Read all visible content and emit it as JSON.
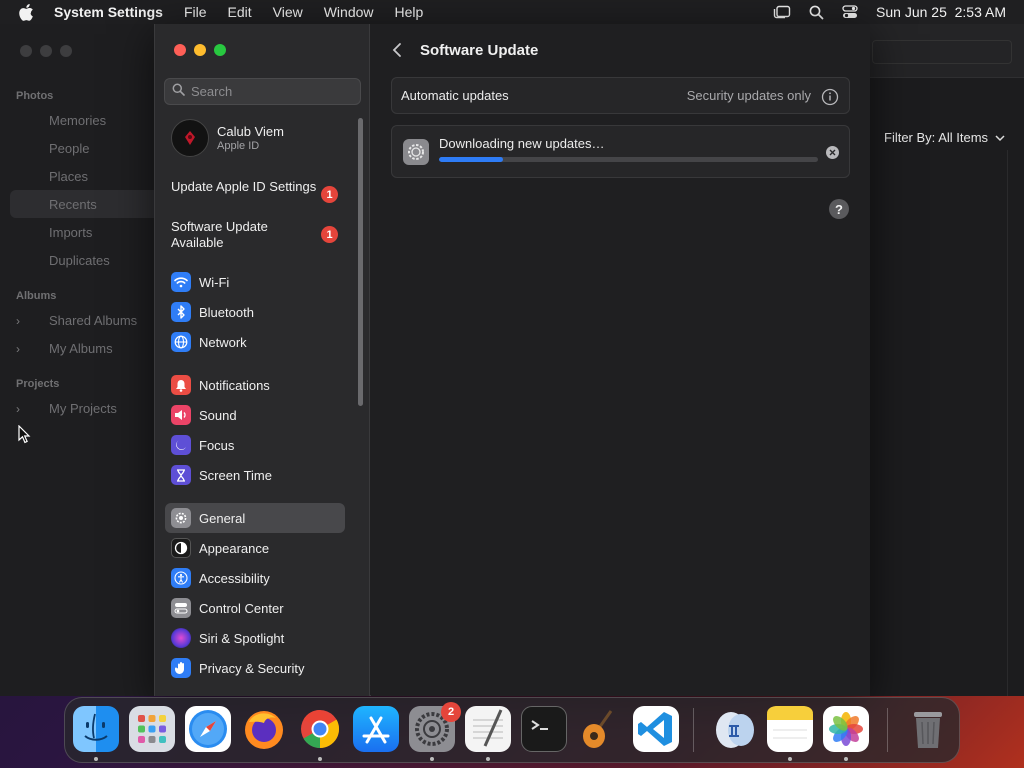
{
  "menubar": {
    "app_name": "System Settings",
    "menus": [
      "File",
      "Edit",
      "View",
      "Window",
      "Help"
    ],
    "datetime": "Sun Jun 25  2:53 AM"
  },
  "photos": {
    "sections": {
      "photos": "Photos",
      "albums": "Albums",
      "projects": "Projects"
    },
    "items": {
      "memories": "Memories",
      "people": "People",
      "places": "Places",
      "recents": "Recents",
      "imports": "Imports",
      "duplicates": "Duplicates",
      "shared_albums": "Shared Albums",
      "my_albums": "My Albums",
      "my_projects": "My Projects"
    },
    "filter_label": "Filter By:",
    "filter_value": "All Items"
  },
  "settings": {
    "search_placeholder": "Search",
    "user": {
      "name": "Calub Viem",
      "subtitle": "Apple ID"
    },
    "notices": [
      {
        "label": "Update Apple ID Settings",
        "badge": "1"
      },
      {
        "label": "Software Update Available",
        "badge": "1"
      }
    ],
    "sidebar": {
      "wifi": "Wi-Fi",
      "bluetooth": "Bluetooth",
      "network": "Network",
      "notifications": "Notifications",
      "sound": "Sound",
      "focus": "Focus",
      "screen_time": "Screen Time",
      "general": "General",
      "appearance": "Appearance",
      "accessibility": "Accessibility",
      "control_center": "Control Center",
      "siri": "Siri & Spotlight",
      "privacy": "Privacy & Security"
    },
    "selected": "General",
    "pane": {
      "title": "Software Update",
      "auto_updates_label": "Automatic updates",
      "auto_updates_value": "Security updates only",
      "download_status": "Downloading new updates…",
      "progress": 0.17,
      "help": "?"
    }
  },
  "dock": {
    "apps": [
      "Finder",
      "Launchpad",
      "Safari",
      "Firefox",
      "Chrome",
      "App Store",
      "System Settings",
      "TextEdit",
      "Terminal",
      "GarageBand",
      "Visual Studio Code",
      "Preview",
      "Notes",
      "Photos",
      "Trash"
    ],
    "settings_badge": "2"
  },
  "colors": {
    "accent": "#2e7cf6",
    "badge": "#e5453b"
  }
}
